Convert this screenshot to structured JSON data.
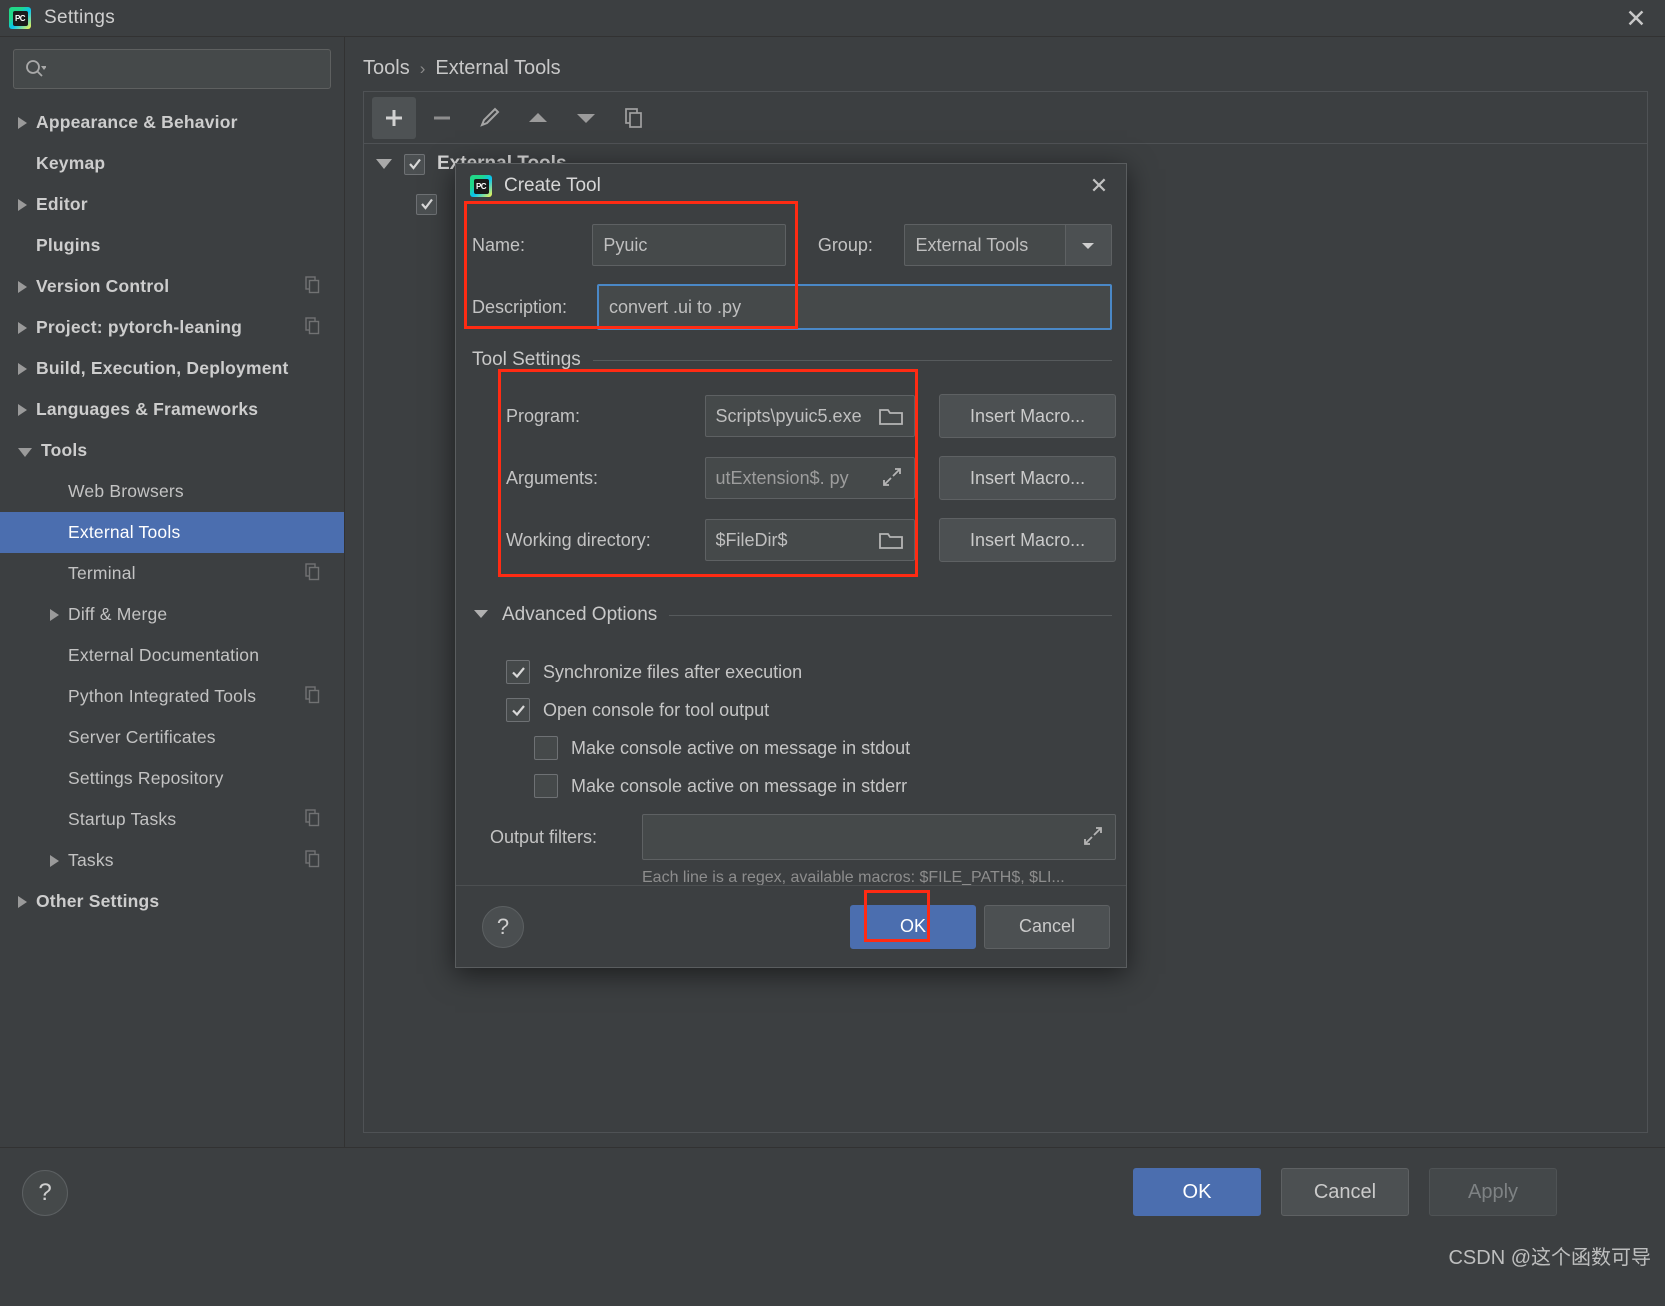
{
  "window": {
    "title": "Settings",
    "app_icon": "pycharm-icon",
    "close_icon": "close-icon"
  },
  "search": {
    "placeholder": "",
    "value": "",
    "icon": "search-icon"
  },
  "sidebar": {
    "items": [
      {
        "label": "Appearance & Behavior",
        "arrow": "right",
        "level": 0,
        "bold": true,
        "badge": false,
        "selected": false
      },
      {
        "label": "Keymap",
        "arrow": "none",
        "level": 0,
        "bold": true,
        "badge": false,
        "selected": false
      },
      {
        "label": "Editor",
        "arrow": "right",
        "level": 0,
        "bold": true,
        "badge": false,
        "selected": false
      },
      {
        "label": "Plugins",
        "arrow": "none",
        "level": 0,
        "bold": true,
        "badge": false,
        "selected": false
      },
      {
        "label": "Version Control",
        "arrow": "right",
        "level": 0,
        "bold": true,
        "badge": true,
        "selected": false
      },
      {
        "label": "Project: pytorch-leaning",
        "arrow": "right",
        "level": 0,
        "bold": true,
        "badge": true,
        "selected": false
      },
      {
        "label": "Build, Execution, Deployment",
        "arrow": "right",
        "level": 0,
        "bold": true,
        "badge": false,
        "selected": false
      },
      {
        "label": "Languages & Frameworks",
        "arrow": "right",
        "level": 0,
        "bold": true,
        "badge": false,
        "selected": false
      },
      {
        "label": "Tools",
        "arrow": "down",
        "level": 0,
        "bold": true,
        "badge": false,
        "selected": false
      },
      {
        "label": "Web Browsers",
        "arrow": "none",
        "level": 1,
        "bold": false,
        "badge": false,
        "selected": false
      },
      {
        "label": "External Tools",
        "arrow": "none",
        "level": 1,
        "bold": false,
        "badge": false,
        "selected": true
      },
      {
        "label": "Terminal",
        "arrow": "none",
        "level": 1,
        "bold": false,
        "badge": true,
        "selected": false
      },
      {
        "label": "Diff & Merge",
        "arrow": "right",
        "level": 2,
        "bold": false,
        "badge": false,
        "selected": false
      },
      {
        "label": "External Documentation",
        "arrow": "none",
        "level": 1,
        "bold": false,
        "badge": false,
        "selected": false
      },
      {
        "label": "Python Integrated Tools",
        "arrow": "none",
        "level": 1,
        "bold": false,
        "badge": true,
        "selected": false
      },
      {
        "label": "Server Certificates",
        "arrow": "none",
        "level": 1,
        "bold": false,
        "badge": false,
        "selected": false
      },
      {
        "label": "Settings Repository",
        "arrow": "none",
        "level": 1,
        "bold": false,
        "badge": false,
        "selected": false
      },
      {
        "label": "Startup Tasks",
        "arrow": "none",
        "level": 1,
        "bold": false,
        "badge": true,
        "selected": false
      },
      {
        "label": "Tasks",
        "arrow": "right",
        "level": 2,
        "bold": false,
        "badge": true,
        "selected": false
      },
      {
        "label": "Other Settings",
        "arrow": "right",
        "level": 0,
        "bold": true,
        "badge": false,
        "selected": false
      }
    ]
  },
  "breadcrumb": {
    "parent": "Tools",
    "separator": "›",
    "current": "External Tools"
  },
  "toolbar": {
    "buttons": [
      {
        "name": "add-button",
        "icon": "plus-icon",
        "active": true
      },
      {
        "name": "remove-button",
        "icon": "minus-icon",
        "active": false
      },
      {
        "name": "edit-button",
        "icon": "pencil-icon",
        "active": false
      },
      {
        "name": "move-up-button",
        "icon": "arrow-up-icon",
        "active": false
      },
      {
        "name": "move-down-button",
        "icon": "arrow-down-icon",
        "active": false
      },
      {
        "name": "copy-button",
        "icon": "copy-icon",
        "active": false
      }
    ]
  },
  "tool_tree": {
    "root_label": "External Tools",
    "root_checked": true
  },
  "dialog": {
    "title": "Create Tool",
    "icon": "pycharm-icon",
    "close_icon": "close-icon",
    "name_label": "Name:",
    "name_value": "Pyuic",
    "group_label": "Group:",
    "group_value": "External Tools",
    "group_dropdown_icon": "chevron-down-icon",
    "description_label": "Description:",
    "description_value": "convert .ui to .py",
    "tool_settings_title": "Tool Settings",
    "program_label": "Program:",
    "program_value": "Scripts\\pyuic5.exe",
    "program_browse_icon": "folder-icon",
    "arguments_label": "Arguments:",
    "arguments_value": "utExtension$. py",
    "arguments_expand_icon": "expand-icon",
    "workdir_label": "Working directory:",
    "workdir_value": "$FileDir$",
    "workdir_browse_icon": "folder-icon",
    "insert_macro_label": "Insert Macro...",
    "advanced_options_title": "Advanced Options",
    "advanced_arrow_icon": "triangle-down-icon",
    "checkboxes": [
      {
        "label": "Synchronize files after execution",
        "checked": true,
        "indent": 0
      },
      {
        "label": "Open console for tool output",
        "checked": true,
        "indent": 0
      },
      {
        "label": "Make console active on message in stdout",
        "checked": false,
        "indent": 1
      },
      {
        "label": "Make console active on message in stderr",
        "checked": false,
        "indent": 1
      }
    ],
    "output_filters_label": "Output filters:",
    "output_filters_value": "",
    "output_filters_expand_icon": "expand-icon",
    "output_filters_hint": "Each line is a regex, available macros: $FILE_PATH$, $LI...",
    "help_icon": "question-mark-icon",
    "ok_label": "OK",
    "cancel_label": "Cancel"
  },
  "bottom_bar": {
    "help_icon": "question-mark-icon",
    "ok_label": "OK",
    "cancel_label": "Cancel",
    "apply_label": "Apply"
  },
  "watermark": "CSDN @这个函数可导",
  "colors": {
    "background": "#3c3f41",
    "selection_blue": "#4b6eaf",
    "annotation_red": "#ff2b13",
    "field_background": "#45494a",
    "focus_border": "#4a88c7"
  }
}
